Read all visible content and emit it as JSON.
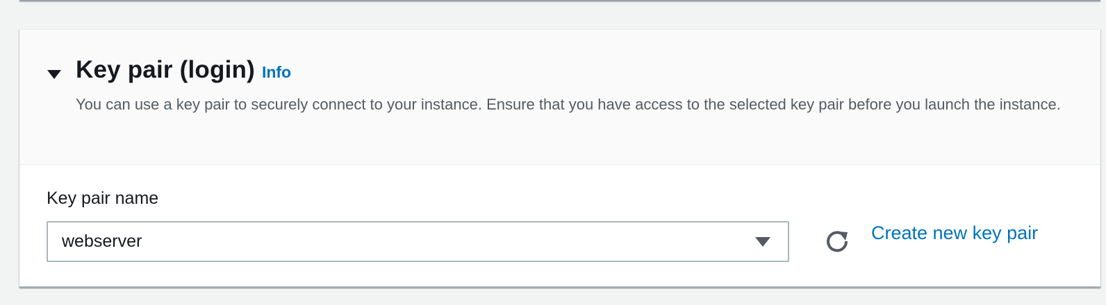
{
  "section": {
    "title": "Key pair (login)",
    "info_label": "Info",
    "description": "You can use a key pair to securely connect to your instance. Ensure that you have access to the selected key pair before you launch the instance."
  },
  "field": {
    "label": "Key pair name",
    "selected_value": "webserver"
  },
  "actions": {
    "refresh_icon": "refresh-icon",
    "create_label": "Create new key pair"
  },
  "colors": {
    "link": "#0073bb",
    "text": "#16191f",
    "secondary_text": "#545b64"
  }
}
